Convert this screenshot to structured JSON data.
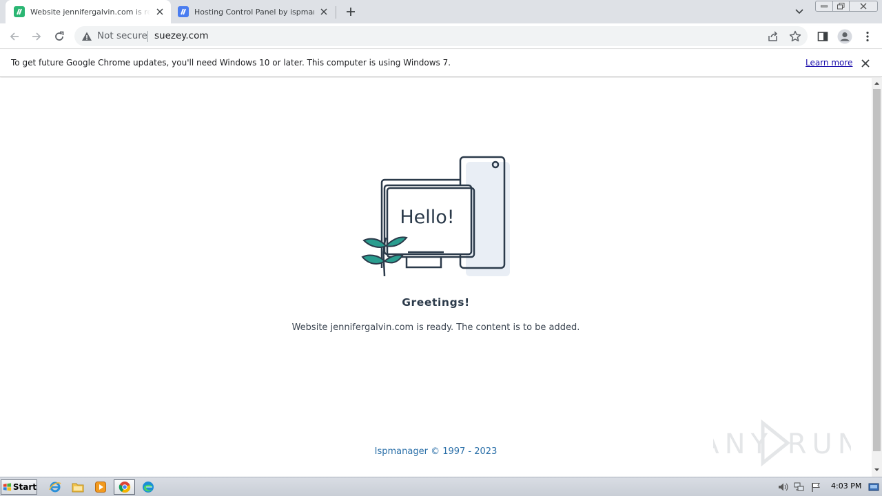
{
  "browser": {
    "tabs": [
      {
        "title": "Website jennifergalvin.com is ready. The content is to be added",
        "active": true
      },
      {
        "title": "Hosting Control Panel by ispmanager",
        "active": false
      }
    ],
    "new_tab_icon": "plus-icon",
    "address_bar": {
      "security_label": "Not secure",
      "url": "suezey.com"
    }
  },
  "infobar": {
    "message": "To get future Google Chrome updates, you'll need Windows 10 or later. This computer is using Windows 7.",
    "learn_more": "Learn more"
  },
  "page": {
    "illustration_text": "Hello!",
    "greeting": "Greetings!",
    "subtitle": "Website jennifergalvin.com is ready. The content is to be added.",
    "footer": "Ispmanager © 1997 - 2023"
  },
  "watermark": {
    "text": "ANY RUN"
  },
  "taskbar": {
    "start_label": "Start",
    "clock": "4:03 PM"
  },
  "colors": {
    "tab_strip": "#dee1e6",
    "favicon": "#2bb673",
    "favicon_ispmanager": "#4a7df0",
    "illustration_stroke": "#2b3a4a",
    "leaf": "#2a9d8f",
    "footer_link": "#2a6fa8"
  }
}
